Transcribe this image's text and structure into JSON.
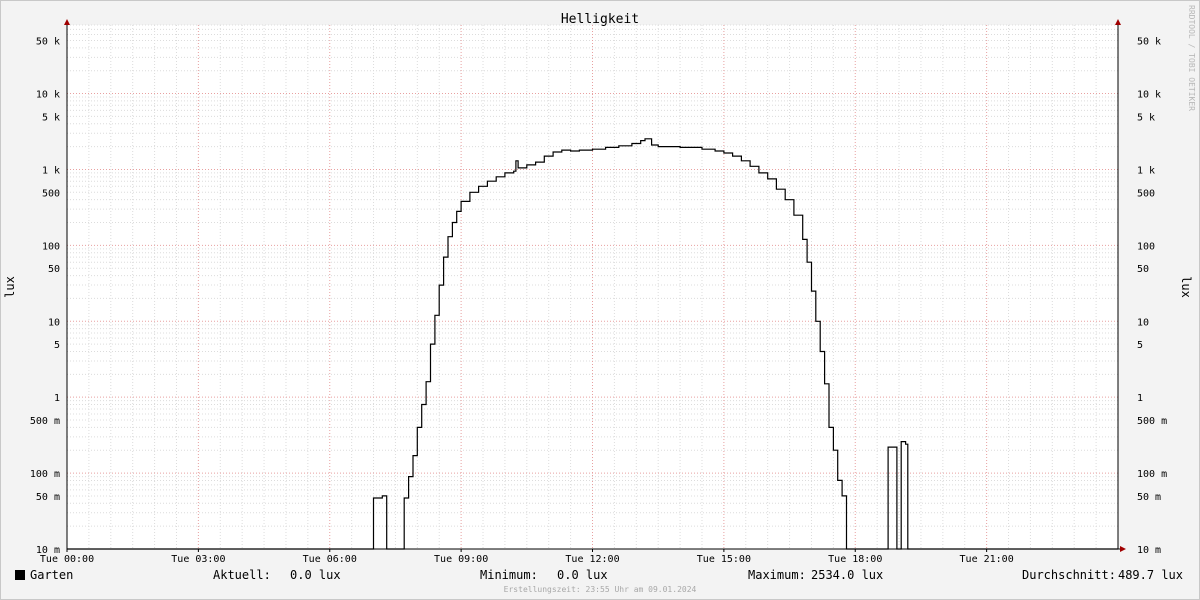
{
  "chart_data": {
    "type": "line",
    "title": "Helligkeit",
    "ylabel_left": "lux",
    "ylabel_right": "lux",
    "y_scale": "log",
    "ylim": [
      0.01,
      80000
    ],
    "x_range_hours": [
      0,
      24
    ],
    "x_ticks": [
      {
        "h": 0,
        "label": "Tue 00:00"
      },
      {
        "h": 3,
        "label": "Tue 03:00"
      },
      {
        "h": 6,
        "label": "Tue 06:00"
      },
      {
        "h": 9,
        "label": "Tue 09:00"
      },
      {
        "h": 12,
        "label": "Tue 12:00"
      },
      {
        "h": 15,
        "label": "Tue 15:00"
      },
      {
        "h": 18,
        "label": "Tue 18:00"
      },
      {
        "h": 21,
        "label": "Tue 21:00"
      }
    ],
    "y_ticks": [
      {
        "v": 50000,
        "label": "50 k"
      },
      {
        "v": 10000,
        "label": "10 k"
      },
      {
        "v": 5000,
        "label": "5 k"
      },
      {
        "v": 1000,
        "label": "1 k"
      },
      {
        "v": 500,
        "label": "500"
      },
      {
        "v": 100,
        "label": "100"
      },
      {
        "v": 50,
        "label": "50"
      },
      {
        "v": 10,
        "label": "10"
      },
      {
        "v": 5,
        "label": "5"
      },
      {
        "v": 1,
        "label": "1"
      },
      {
        "v": 0.5,
        "label": "500 m"
      },
      {
        "v": 0.1,
        "label": "100 m"
      },
      {
        "v": 0.05,
        "label": "50 m"
      },
      {
        "v": 0.01,
        "label": "10 m"
      }
    ],
    "series": [
      {
        "name": "Garten",
        "color": "#000000",
        "points": [
          [
            0,
            0.01
          ],
          [
            6.95,
            0.01
          ],
          [
            7.0,
            0.047
          ],
          [
            7.2,
            0.05
          ],
          [
            7.3,
            0.01
          ],
          [
            7.6,
            0.01
          ],
          [
            7.7,
            0.047
          ],
          [
            7.8,
            0.09
          ],
          [
            7.9,
            0.17
          ],
          [
            8.0,
            0.4
          ],
          [
            8.1,
            0.8
          ],
          [
            8.2,
            1.6
          ],
          [
            8.3,
            5
          ],
          [
            8.4,
            12
          ],
          [
            8.5,
            30
          ],
          [
            8.6,
            70
          ],
          [
            8.7,
            130
          ],
          [
            8.8,
            200
          ],
          [
            8.9,
            280
          ],
          [
            9.0,
            380
          ],
          [
            9.2,
            500
          ],
          [
            9.4,
            600
          ],
          [
            9.6,
            700
          ],
          [
            9.8,
            800
          ],
          [
            10.0,
            900
          ],
          [
            10.2,
            950
          ],
          [
            10.25,
            1300
          ],
          [
            10.3,
            1050
          ],
          [
            10.5,
            1150
          ],
          [
            10.7,
            1250
          ],
          [
            10.9,
            1500
          ],
          [
            11.1,
            1700
          ],
          [
            11.3,
            1800
          ],
          [
            11.5,
            1750
          ],
          [
            11.7,
            1800
          ],
          [
            12.0,
            1850
          ],
          [
            12.3,
            1950
          ],
          [
            12.6,
            2050
          ],
          [
            12.9,
            2200
          ],
          [
            13.1,
            2400
          ],
          [
            13.2,
            2534
          ],
          [
            13.35,
            2100
          ],
          [
            13.5,
            2000
          ],
          [
            14.0,
            1950
          ],
          [
            14.5,
            1850
          ],
          [
            14.8,
            1750
          ],
          [
            15.0,
            1650
          ],
          [
            15.2,
            1500
          ],
          [
            15.4,
            1300
          ],
          [
            15.6,
            1100
          ],
          [
            15.8,
            900
          ],
          [
            16.0,
            750
          ],
          [
            16.2,
            550
          ],
          [
            16.4,
            400
          ],
          [
            16.6,
            250
          ],
          [
            16.8,
            120
          ],
          [
            16.9,
            60
          ],
          [
            17.0,
            25
          ],
          [
            17.1,
            10
          ],
          [
            17.2,
            4
          ],
          [
            17.3,
            1.5
          ],
          [
            17.4,
            0.4
          ],
          [
            17.5,
            0.2
          ],
          [
            17.6,
            0.08
          ],
          [
            17.7,
            0.05
          ],
          [
            17.8,
            0.01
          ],
          [
            18.7,
            0.01
          ],
          [
            18.75,
            0.22
          ],
          [
            18.9,
            0.22
          ],
          [
            18.95,
            0.01
          ],
          [
            19.0,
            0.01
          ],
          [
            19.05,
            0.26
          ],
          [
            19.15,
            0.24
          ],
          [
            19.2,
            0.01
          ],
          [
            24,
            0.01
          ]
        ]
      }
    ]
  },
  "side_note": "RRDTOOL / TOBI OETIKER",
  "legend": {
    "series_name": "Garten",
    "aktuell_label": "Aktuell:",
    "aktuell_value": "0.0 lux",
    "minimum_label": "Minimum:",
    "minimum_value": "0.0 lux",
    "maximum_label": "Maximum:",
    "maximum_value": "2534.0 lux",
    "durchschnitt_label": "Durchschnitt:",
    "durchschnitt_value": "489.7 lux"
  },
  "footer": "Erstellungszeit: 23:55 Uhr am 09.01.2024"
}
